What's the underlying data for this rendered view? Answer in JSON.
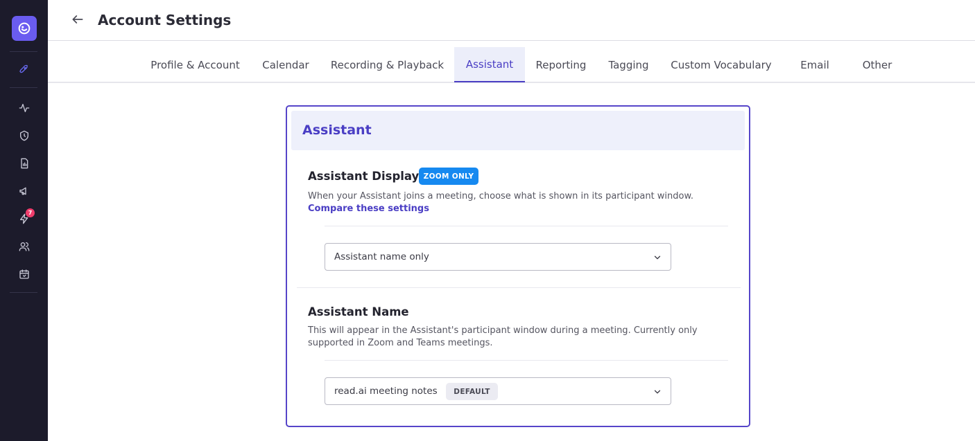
{
  "sidebar": {
    "logo_icon": "read-ai-logo-icon",
    "items": [
      {
        "name": "launch",
        "icon": "rocket-icon",
        "active": true
      },
      {
        "name": "activity",
        "icon": "pulse-icon"
      },
      {
        "name": "security",
        "icon": "shield-icon"
      },
      {
        "name": "reports",
        "icon": "report-icon"
      },
      {
        "name": "announcements",
        "icon": "megaphone-icon"
      },
      {
        "name": "integrations",
        "icon": "lightning-icon",
        "badge": "7"
      },
      {
        "name": "people",
        "icon": "people-icon"
      },
      {
        "name": "calendar",
        "icon": "calendar-icon"
      }
    ]
  },
  "header": {
    "title": "Account Settings",
    "back_icon": "arrow-left-icon"
  },
  "tabs": [
    {
      "label": "Profile & Account"
    },
    {
      "label": "Calendar"
    },
    {
      "label": "Recording & Playback"
    },
    {
      "label": "Assistant",
      "active": true
    },
    {
      "label": "Reporting"
    },
    {
      "label": "Tagging"
    },
    {
      "label": "Custom Vocabulary"
    },
    {
      "label": "Email"
    },
    {
      "label": "Other"
    }
  ],
  "card": {
    "title": "Assistant",
    "display": {
      "title": "Assistant Display",
      "badge": "ZOOM ONLY",
      "description": "When your Assistant joins a meeting, choose what is shown in its participant window.",
      "link": "Compare these settings",
      "selected": "Assistant name only"
    },
    "name": {
      "title": "Assistant Name",
      "description": "This will appear in the Assistant's participant window during a meeting. Currently only supported in Zoom and Teams meetings.",
      "selected": "read.ai meeting notes",
      "badge": "DEFAULT"
    }
  },
  "colors": {
    "accent": "#4a3ec4",
    "sidebar": "#1c1b2b",
    "zoom_badge": "#1689f0",
    "notification": "#ef3d6c"
  }
}
